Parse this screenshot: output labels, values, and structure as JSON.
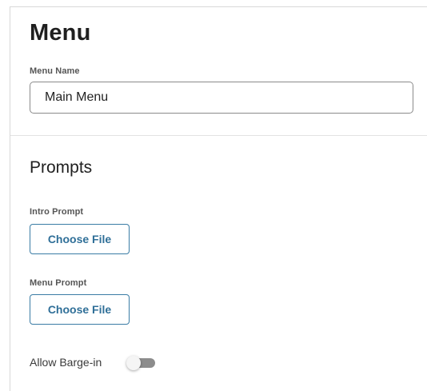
{
  "menu_section": {
    "title": "Menu",
    "menu_name_label": "Menu Name",
    "menu_name_value": "Main Menu"
  },
  "prompts_section": {
    "title": "Prompts",
    "intro_prompt_label": "Intro Prompt",
    "intro_prompt_button": "Choose File",
    "menu_prompt_label": "Menu Prompt",
    "menu_prompt_button": "Choose File",
    "barge_in_label": "Allow Barge-in",
    "barge_in_enabled": false
  },
  "colors": {
    "accent": "#2f6f98",
    "accent_border": "#3a7ca5",
    "toggle_off_track": "#8c8c8c"
  }
}
